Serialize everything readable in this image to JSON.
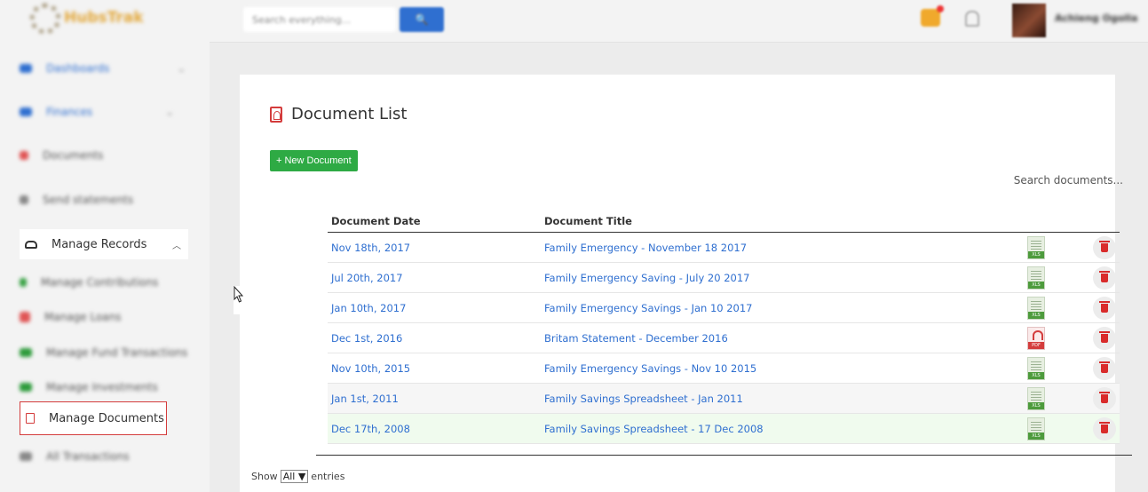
{
  "app": {
    "brand": "HubsTrak"
  },
  "sidebar": {
    "items": [
      {
        "label": "Dashboards"
      },
      {
        "label": "Finances"
      },
      {
        "label": "Documents"
      },
      {
        "label": "Send statements"
      },
      {
        "label": "Manage Records"
      },
      {
        "label": "Manage Contributions"
      },
      {
        "label": "Manage Loans"
      },
      {
        "label": "Manage Fund Transactions"
      },
      {
        "label": "Manage Investments"
      },
      {
        "label": "Manage Documents"
      },
      {
        "label": "All Transactions"
      }
    ]
  },
  "topbar": {
    "search_placeholder": "Search everything...",
    "user": "Achieng Ogolla"
  },
  "main": {
    "title": "Document List",
    "new_button": "+ New Document",
    "search_label": "Search documents...",
    "columns": [
      "Document Date",
      "Document Title"
    ],
    "rows": [
      {
        "date": "Nov 18th, 2017",
        "title": "Family Emergency - November 18 2017",
        "type": "XLS"
      },
      {
        "date": "Jul 20th, 2017",
        "title": "Family Emergency Saving - July 20 2017",
        "type": "XLS"
      },
      {
        "date": "Jan 10th, 2017",
        "title": "Family Emergency Savings - Jan 10 2017",
        "type": "XLS"
      },
      {
        "date": "Dec 1st, 2016",
        "title": "Britam Statement - December 2016",
        "type": "PDF"
      },
      {
        "date": "Nov 10th, 2015",
        "title": "Family Emergency Savings - Nov 10 2015",
        "type": "XLS"
      },
      {
        "date": "Jan 1st, 2011",
        "title": "Family Savings Spreadsheet - Jan 2011",
        "type": "XLS"
      },
      {
        "date": "Dec 17th, 2008",
        "title": "Family Savings Spreadsheet - 17 Dec 2008",
        "type": "XLS"
      }
    ],
    "footer": {
      "show": "Show",
      "selected": "All",
      "entries": "entries"
    }
  },
  "colors": {
    "accent": "#2f6fd0",
    "success": "#2eaa44",
    "danger": "#d43c3c"
  }
}
